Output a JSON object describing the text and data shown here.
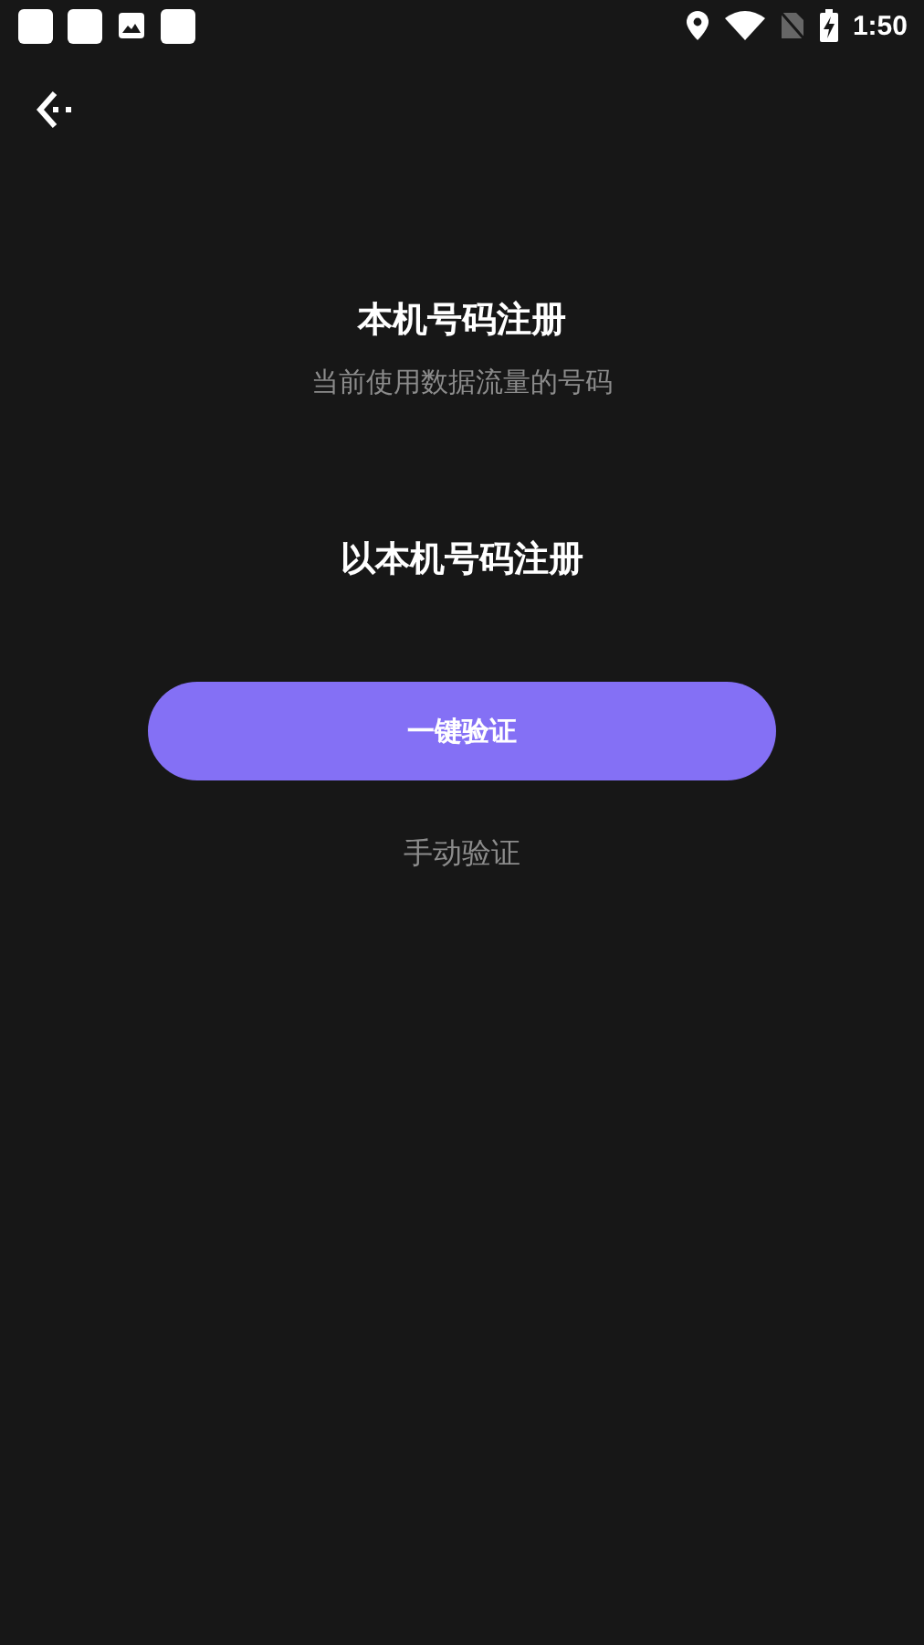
{
  "status_bar": {
    "time": "1:50"
  },
  "title": "本机号码注册",
  "subtitle": "当前使用数据流量的号码",
  "phone_label": "以本机号码注册",
  "primary_button": "一键验证",
  "secondary_link": "手动验证"
}
